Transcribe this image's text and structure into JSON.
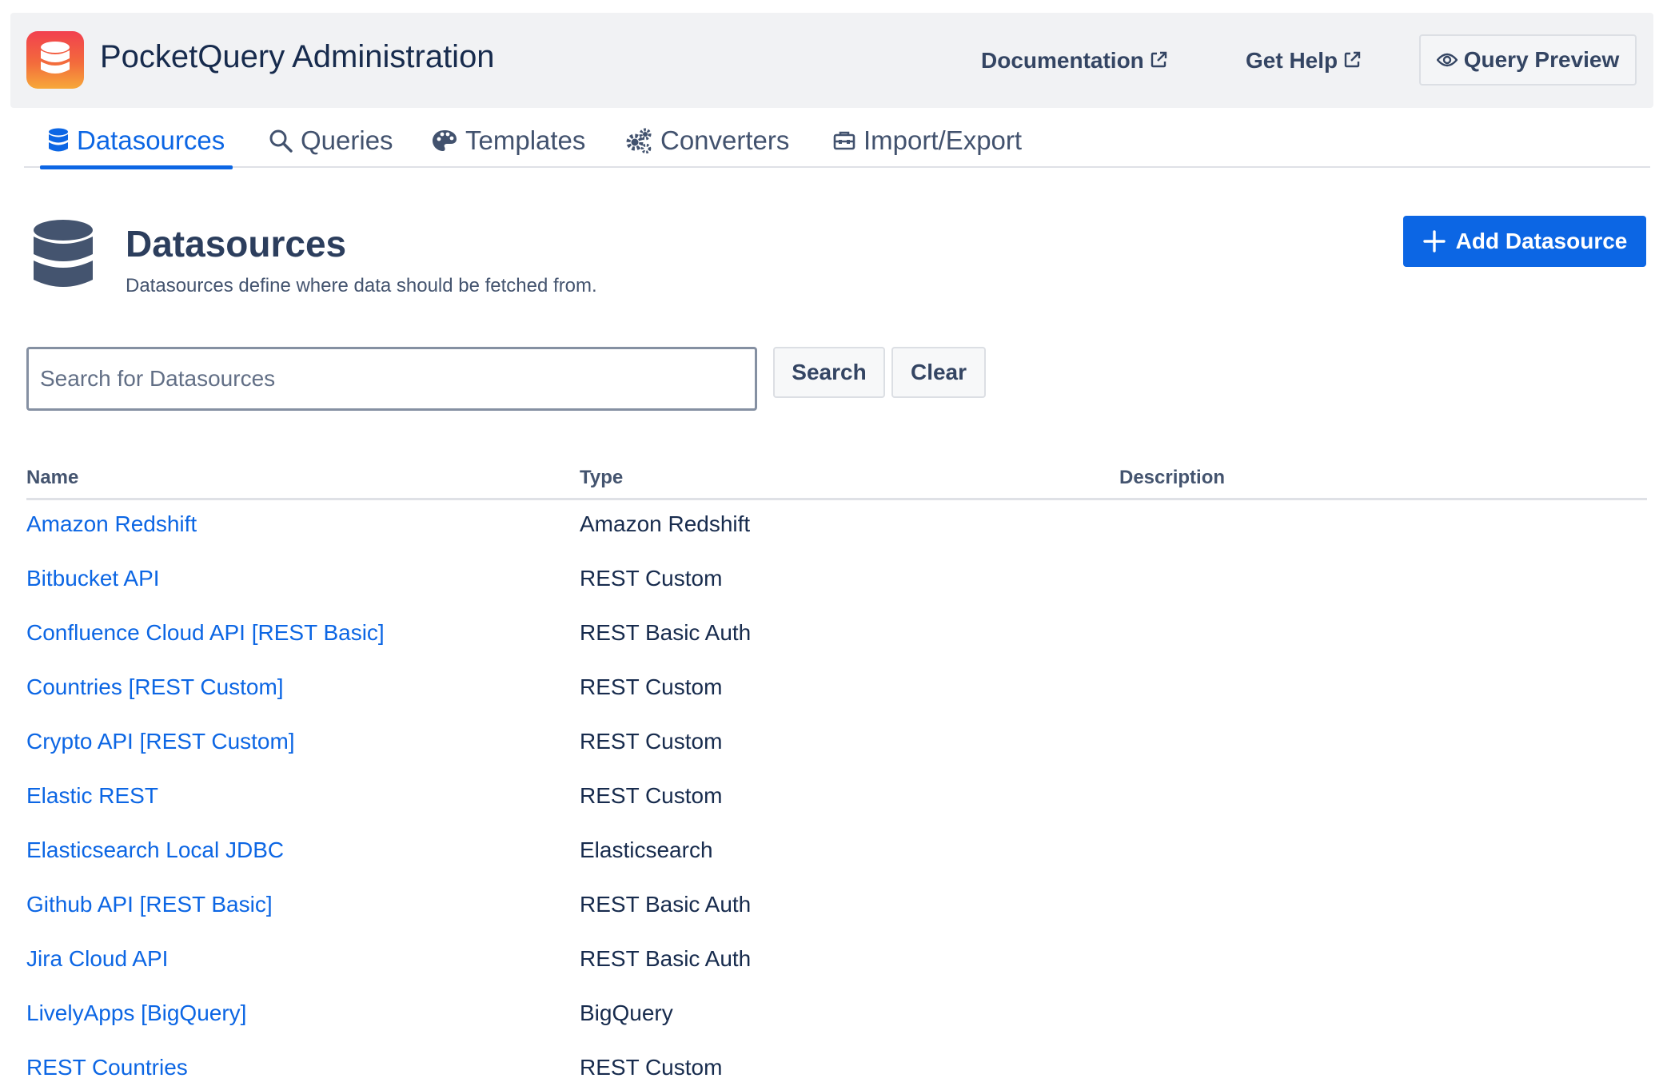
{
  "header": {
    "title": "PocketQuery Administration",
    "logo_icon": "database-icon",
    "links": {
      "documentation": "Documentation",
      "get_help": "Get Help"
    },
    "query_preview_label": "Query Preview"
  },
  "tabs": [
    {
      "label": "Datasources",
      "icon": "database-icon",
      "active": true
    },
    {
      "label": "Queries",
      "icon": "search-icon",
      "active": false
    },
    {
      "label": "Templates",
      "icon": "palette-icon",
      "active": false
    },
    {
      "label": "Converters",
      "icon": "gears-icon",
      "active": false
    },
    {
      "label": "Import/Export",
      "icon": "toolbox-icon",
      "active": false
    }
  ],
  "page": {
    "title": "Datasources",
    "subtitle": "Datasources define where data should be fetched from.",
    "add_button_label": "Add Datasource"
  },
  "search": {
    "placeholder": "Search for Datasources",
    "value": "",
    "search_label": "Search",
    "clear_label": "Clear"
  },
  "table": {
    "columns": [
      "Name",
      "Type",
      "Description"
    ],
    "rows": [
      {
        "name": "Amazon Redshift",
        "type": "Amazon Redshift",
        "description": ""
      },
      {
        "name": "Bitbucket API",
        "type": "REST Custom",
        "description": ""
      },
      {
        "name": "Confluence Cloud API [REST Basic]",
        "type": "REST Basic Auth",
        "description": ""
      },
      {
        "name": "Countries [REST Custom]",
        "type": "REST Custom",
        "description": ""
      },
      {
        "name": "Crypto API [REST Custom]",
        "type": "REST Custom",
        "description": ""
      },
      {
        "name": "Elastic REST",
        "type": "REST Custom",
        "description": ""
      },
      {
        "name": "Elasticsearch Local JDBC",
        "type": "Elasticsearch",
        "description": ""
      },
      {
        "name": "Github API [REST Basic]",
        "type": "REST Basic Auth",
        "description": ""
      },
      {
        "name": "Jira Cloud API",
        "type": "REST Basic Auth",
        "description": ""
      },
      {
        "name": "LivelyApps [BigQuery]",
        "type": "BigQuery",
        "description": ""
      },
      {
        "name": "REST Countries",
        "type": "REST Custom",
        "description": ""
      }
    ]
  },
  "colors": {
    "accent": "#0c66e4",
    "header_bg": "#f1f2f4",
    "logo_gradient": [
      "#f2404f",
      "#f7a93a"
    ]
  }
}
